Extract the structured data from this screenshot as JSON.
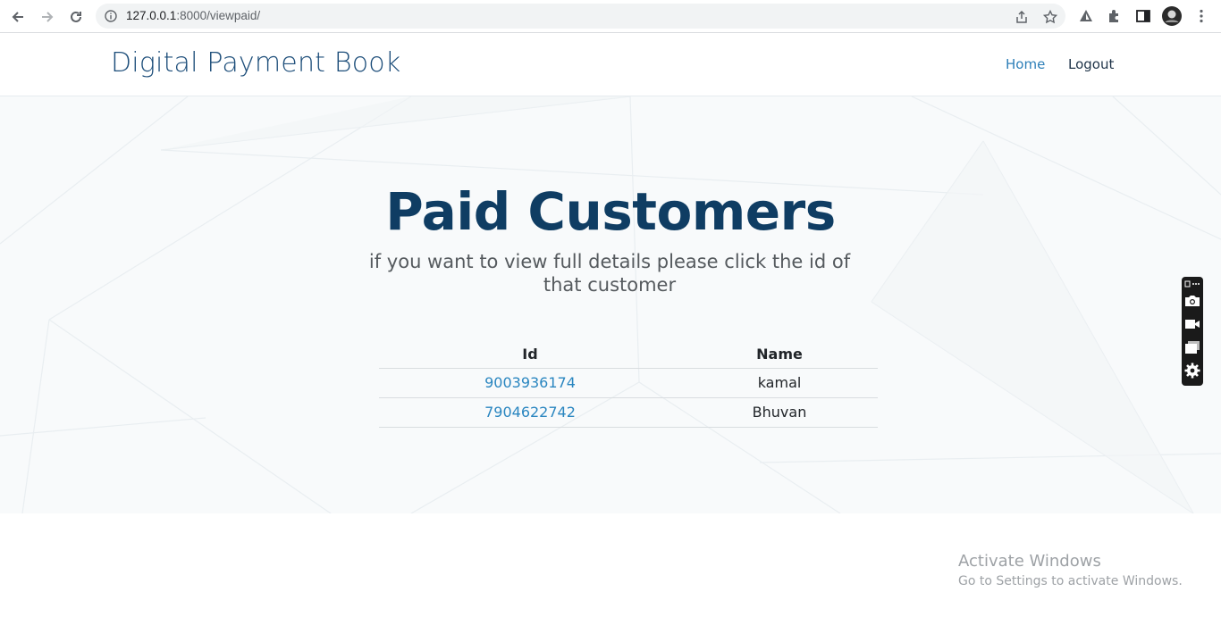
{
  "browser": {
    "url_host": "127.0.0.1",
    "url_rest": ":8000/viewpaid/"
  },
  "header": {
    "brand": "Digital Payment Book",
    "nav": [
      {
        "label": "Home"
      },
      {
        "label": "Logout"
      }
    ]
  },
  "hero": {
    "title": "Paid Customers",
    "subtitle": "if you want to view full details please click the id of that customer"
  },
  "table": {
    "columns": [
      "Id",
      "Name"
    ],
    "rows": [
      {
        "id": "9003936174",
        "name": "kamal"
      },
      {
        "id": "7904622742",
        "name": "Bhuvan"
      }
    ]
  },
  "watermark": {
    "line1": "Activate Windows",
    "line2": "Go to Settings to activate Windows."
  },
  "colors": {
    "brand": "#1d4e7a",
    "title": "#0f3d63",
    "link": "#2a86c0"
  }
}
